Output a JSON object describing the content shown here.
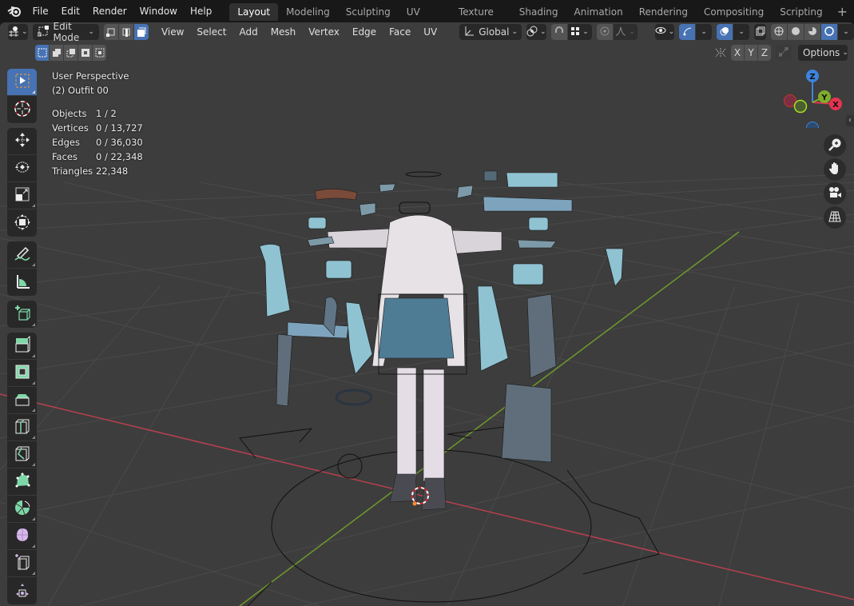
{
  "menu": {
    "items": [
      "File",
      "Edit",
      "Render",
      "Window",
      "Help"
    ]
  },
  "workspaces": {
    "tabs": [
      "Layout",
      "Modeling",
      "Sculpting",
      "UV Editing",
      "Texture Paint",
      "Shading",
      "Animation",
      "Rendering",
      "Compositing",
      "Scripting"
    ],
    "active": "Layout",
    "add_label": "+"
  },
  "header": {
    "mode": "Edit Mode",
    "menus": [
      "View",
      "Select",
      "Add",
      "Mesh",
      "Vertex",
      "Edge",
      "Face",
      "UV"
    ],
    "transform_orientation": "Global",
    "select_mode_active": "face",
    "viewport_shading_active": "rendered"
  },
  "header2": {
    "axes": [
      "X",
      "Y",
      "Z"
    ],
    "options_label": "Options"
  },
  "overlay": {
    "view_name": "User Perspective",
    "object_name": "(2) Outfit 00",
    "stats": [
      {
        "label": "Objects",
        "value": "1 / 2"
      },
      {
        "label": "Vertices",
        "value": "0 / 13,727"
      },
      {
        "label": "Edges",
        "value": "0 / 36,030"
      },
      {
        "label": "Faces",
        "value": "0 / 22,348"
      },
      {
        "label": "Triangles",
        "value": "22,348"
      }
    ]
  },
  "gizmo": {
    "axes": {
      "x": "X",
      "y": "Y",
      "z": "Z"
    },
    "colors": {
      "x": "#e5344f",
      "y": "#7fad2a",
      "z": "#3d84dc"
    }
  },
  "tools": [
    "select-box",
    "cursor",
    "move",
    "rotate",
    "scale",
    "transform",
    "annotate",
    "measure",
    "add-cube",
    "extrude-region",
    "inset-faces",
    "bevel",
    "loop-cut",
    "knife",
    "poly-build",
    "spin",
    "smooth",
    "shrink-fatten",
    "shear"
  ],
  "colors": {
    "accent": "#4772b3",
    "viewport_bg": "#3d3d3d",
    "x_axis_line": "#c0404f",
    "y_axis_line": "#6f9a2a"
  }
}
